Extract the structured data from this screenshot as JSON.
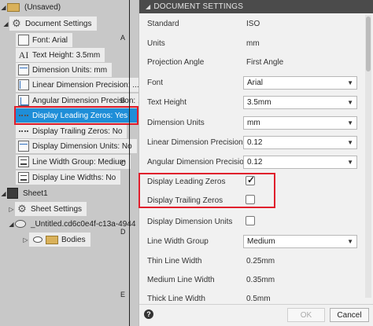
{
  "tree": {
    "root_label": "(Unsaved)",
    "doc_settings_label": "Document Settings",
    "items": [
      {
        "label": "Font: Arial",
        "icon": "font-icon"
      },
      {
        "label": "Text Height: 3.5mm",
        "icon": "text-height-icon"
      },
      {
        "label": "Dimension Units: mm",
        "icon": "dimension-units-icon"
      },
      {
        "label": "Linear Dimension Precision: ...",
        "icon": "linear-dimension-icon"
      },
      {
        "label": "Angular Dimension Precision: ...",
        "icon": "angular-dimension-icon"
      },
      {
        "label": "Display Leading Zeros: Yes",
        "icon": "leading-zeros-icon",
        "selected": true
      },
      {
        "label": "Display Trailing Zeros: No",
        "icon": "trailing-zeros-icon"
      },
      {
        "label": "Display Dimension Units: No",
        "icon": "display-units-icon"
      },
      {
        "label": "Line Width Group: Medium",
        "icon": "line-width-icon"
      },
      {
        "label": "Display Line Widths: No",
        "icon": "line-widths-icon"
      }
    ],
    "sheet_label": "Sheet1",
    "sheet_settings_label": "Sheet Settings",
    "untitled_label": "_Untitled.cd6c0e4f-c13a-4944",
    "bodies_label": "Bodies",
    "highlight_color": "#e01e2c",
    "selected_color": "#1e8ed8"
  },
  "drawing": {
    "letters": [
      "A",
      "B",
      "C",
      "D",
      "E"
    ]
  },
  "dialog": {
    "title": "DOCUMENT SETTINGS",
    "standard_label": "Standard",
    "standard_value": "ISO",
    "units_label": "Units",
    "units_value": "mm",
    "projection_label": "Projection Angle",
    "projection_value": "First Angle",
    "font_label": "Font",
    "font_value": "Arial",
    "text_height_label": "Text Height",
    "text_height_value": "3.5mm",
    "dim_units_label": "Dimension Units",
    "dim_units_value": "mm",
    "linear_prec_label": "Linear Dimension Precision",
    "linear_prec_value": "0.12",
    "angular_prec_label": "Angular Dimension Precision",
    "angular_prec_value": "0.12",
    "leading_zeros_label": "Display Leading Zeros",
    "leading_zeros_checked": true,
    "trailing_zeros_label": "Display Trailing Zeros",
    "trailing_zeros_checked": false,
    "display_units_label": "Display Dimension Units",
    "display_units_checked": false,
    "line_width_group_label": "Line Width Group",
    "line_width_group_value": "Medium",
    "thin_label": "Thin Line Width",
    "thin_value": "0.25mm",
    "medium_label": "Medium Line Width",
    "medium_value": "0.35mm",
    "thick_label": "Thick Line Width",
    "thick_value": "0.5mm",
    "ok_label": "OK",
    "cancel_label": "Cancel"
  }
}
